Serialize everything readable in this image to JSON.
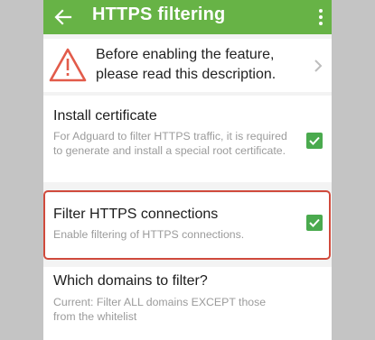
{
  "appbar": {
    "title": "HTTPS filtering",
    "back_icon": "arrow-left-icon",
    "menu_icon": "more-vertical-icon"
  },
  "notice": {
    "icon": "warning-triangle-icon",
    "text": "Before enabling the feature, please read this description.",
    "chevron_icon": "chevron-right-icon"
  },
  "settings": [
    {
      "title": "Install certificate",
      "subtitle": "For Adguard to filter HTTPS traffic, it is required to generate and install a special root certificate.",
      "checked": true
    },
    {
      "title": "Filter HTTPS connections",
      "subtitle": "Enable filtering of HTTPS connections.",
      "checked": true,
      "highlighted": true
    },
    {
      "title": "Which domains to filter?",
      "subtitle": "Current: Filter ALL domains EXCEPT those from the whitelist"
    }
  ],
  "colors": {
    "appbar": "#67b346",
    "checkbox": "#4aaa4e",
    "warning": "#e25b4a",
    "highlight_border": "#d04a3c"
  }
}
